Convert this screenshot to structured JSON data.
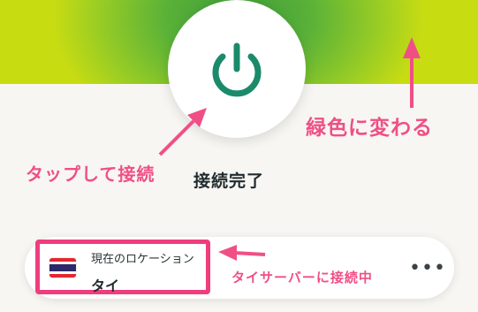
{
  "status": {
    "label": "接続完了"
  },
  "annotations": {
    "color_change": "緑色に変わる",
    "tap_to_connect": "タップして接続",
    "server_connected": "タイサーバーに接続中"
  },
  "location": {
    "label": "現在のロケーション",
    "value": "タイ"
  },
  "more_label": "•••",
  "colors": {
    "accent_green": "#1b8a6b",
    "annotation_pink": "#f04f86",
    "hero_green": "#5bb238",
    "hero_yellow": "#c8dc12"
  },
  "icons": [
    "power-icon",
    "thailand-flag-icon",
    "more-icon"
  ]
}
